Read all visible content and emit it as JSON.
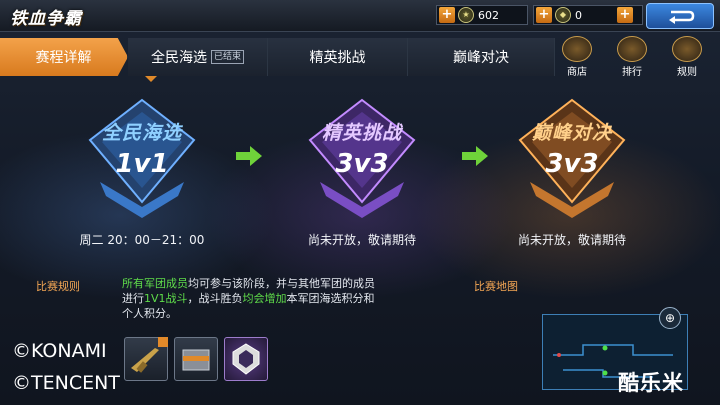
{
  "header": {
    "title": "铁血争霸",
    "currency1": {
      "value": "602",
      "icon": "medal-coin-icon"
    },
    "currency2": {
      "value": "0",
      "icon": "shield-coin-icon"
    }
  },
  "tabs": [
    {
      "label": "赛程详解",
      "active": true
    },
    {
      "label": "全民海选",
      "tag": "已结束"
    },
    {
      "label": "精英挑战"
    },
    {
      "label": "巅峰对决"
    }
  ],
  "side_buttons": {
    "shop": "商店",
    "rank": "排行",
    "rules": "规则"
  },
  "stages": [
    {
      "name": "全民海选",
      "mode": "1v1",
      "info": "周二 20：00－21：00",
      "color": "#6fb0ff"
    },
    {
      "name": "精英挑战",
      "mode": "3v3",
      "info": "尚未开放，敬请期待",
      "color": "#c38bff"
    },
    {
      "name": "巅峰对决",
      "mode": "3v3",
      "info": "尚未开放，敬请期待",
      "color": "#ffb25a"
    }
  ],
  "bottom": {
    "rules_label": "比赛规则",
    "map_label": "比赛地图",
    "rules": {
      "p1": "所有军团成员",
      "p2": "均可参与该阶段，并与其他军团的成员",
      "p3": "进行",
      "p4": "1V1战斗",
      "p5": "，战斗胜负",
      "p6": "均会增加",
      "p7": "本军团海选积分和",
      "p8": "个人积分。"
    }
  },
  "watermarks": {
    "konami": "©KONAMI",
    "tencent": "©TENCENT",
    "site": "酷乐米"
  },
  "colors": {
    "accent_orange": "#e08a2a",
    "highlight_green": "#5fdc4a",
    "back_blue": "#2f74c8"
  }
}
